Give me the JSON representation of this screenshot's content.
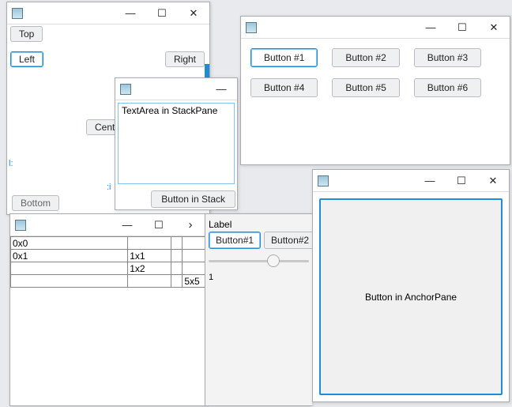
{
  "glyphs": {
    "min": "—",
    "max": "☐",
    "close": "✕",
    "more": "›"
  },
  "w1": {
    "top": "Top",
    "left": "Left",
    "right": "Right",
    "center": "Cent",
    "bottom": "Bottom",
    "mark1": "l:",
    "mark2": ":i"
  },
  "w2": {
    "textarea_value": "TextArea in StackPane",
    "button": "Button in Stack"
  },
  "w3": {
    "buttons": [
      "Button #1",
      "Button #2",
      "Button #3",
      "Button #4",
      "Button #5",
      "Button #6"
    ]
  },
  "w4": {
    "cells": {
      "r0c0": "0x0",
      "r1c0": "0x1",
      "r1c1": "1x1",
      "r2c1": "1x2",
      "r3c3": "5x5"
    }
  },
  "w5": {
    "label": "Label",
    "btn1": "Button#1",
    "btn2": "Button#2",
    "slider_value": "1"
  },
  "w6": {
    "button": "Button in AnchorPane"
  }
}
